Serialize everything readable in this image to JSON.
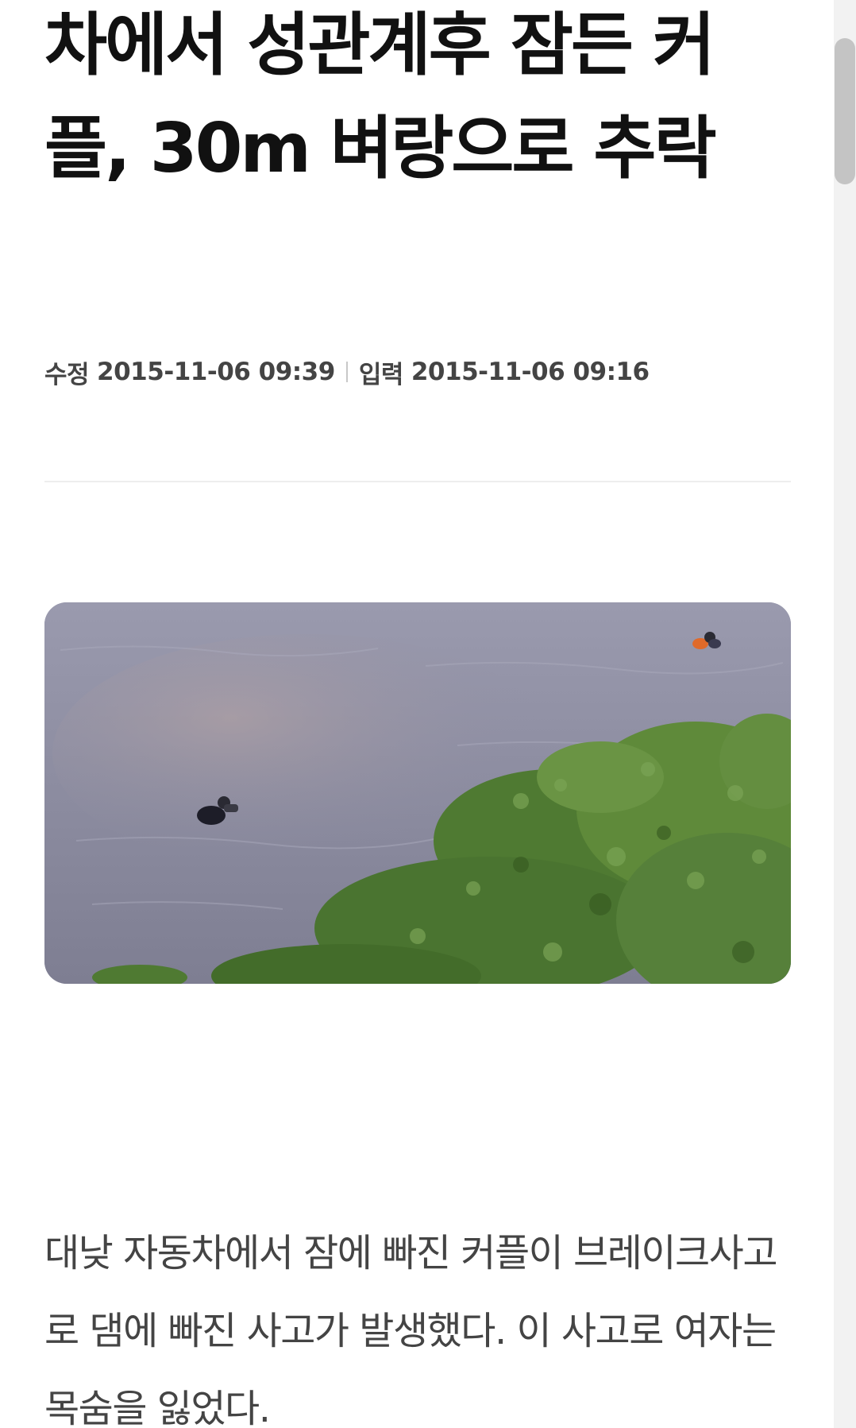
{
  "article": {
    "title": "차에서 성관계후 잠든 커플, 30m 벼랑으로 추락",
    "modified_label": "수정",
    "modified_time": "2015-11-06 09:39",
    "published_label": "입력",
    "published_time": "2015-11-06 09:16",
    "body": "대낮 자동차에서 잠에 빠진 커플이 브레이크사고로 댐에 빠진 사고가 발생했다. 이 사고로 여자는 목숨을 잃었다."
  },
  "colors": {
    "title": "#111111",
    "meta": "#444444",
    "body": "#444444",
    "water": "#8e8ea2",
    "foliage": "#5f8a3a"
  }
}
